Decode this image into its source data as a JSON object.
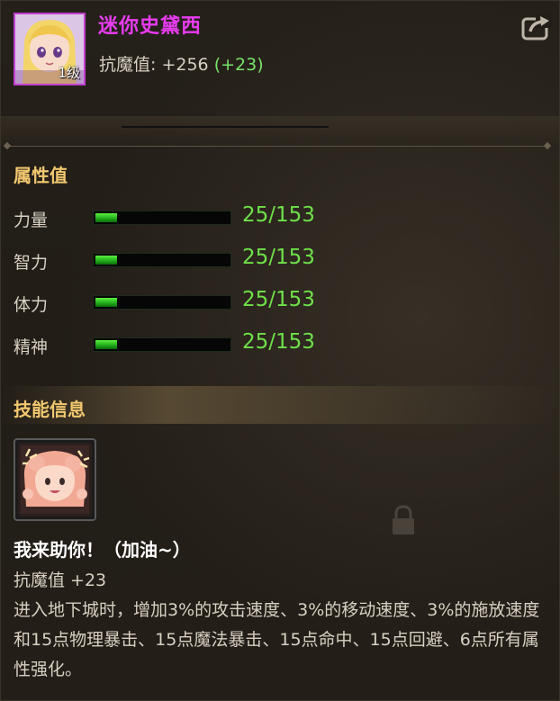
{
  "pet": {
    "name": "迷你史黛西",
    "level_badge": "1级",
    "resist_label": "抗魔值: ",
    "resist_value": "+256",
    "resist_bonus": "(+23)"
  },
  "header": {
    "share_icon": "share-icon"
  },
  "attributes": {
    "title": "属性值",
    "stats": [
      {
        "label": "力量",
        "value": "25/153",
        "fraction": 0.163
      },
      {
        "label": "智力",
        "value": "25/153",
        "fraction": 0.163
      },
      {
        "label": "体力",
        "value": "25/153",
        "fraction": 0.163
      },
      {
        "label": "精神",
        "value": "25/153",
        "fraction": 0.163
      }
    ]
  },
  "skill": {
    "section_title": "技能信息",
    "icon": "cheer-skill-icon",
    "name": "我来助你！（加油~）",
    "resist_line": "抗魔值 +23",
    "description": "进入地下城时，增加3%的攻击速度、3%的移动速度、3%的施放速度和15点物理暴击、15点魔法暴击、15点命中、15点回避、6点所有属性强化。"
  },
  "colors": {
    "name": "#e83cf0",
    "section_title": "#f2c86f",
    "bar_fill": "#3ad12a",
    "value_green": "#6fe04a"
  }
}
